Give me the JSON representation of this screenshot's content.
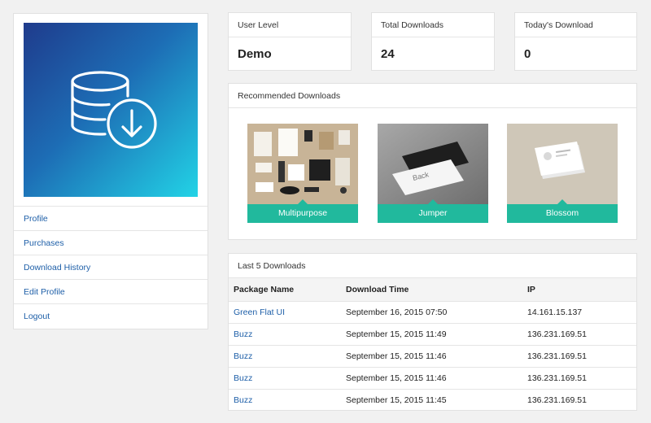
{
  "sidebar": {
    "avatar_icon": "database-download-icon",
    "menu": [
      "Profile",
      "Purchases",
      "Download History",
      "Edit Profile",
      "Logout"
    ]
  },
  "stats": [
    {
      "label": "User Level",
      "value": "Demo"
    },
    {
      "label": "Total Downloads",
      "value": "24"
    },
    {
      "label": "Today's Download",
      "value": "0"
    }
  ],
  "recommended": {
    "title": "Recommended Downloads",
    "items": [
      {
        "name": "Multipurpose"
      },
      {
        "name": "Jumper"
      },
      {
        "name": "Blossom"
      }
    ]
  },
  "downloads": {
    "title": "Last 5 Downloads",
    "columns": [
      "Package Name",
      "Download Time",
      "IP"
    ],
    "rows": [
      [
        "Green Flat UI",
        "September 16, 2015 07:50",
        "14.161.15.137"
      ],
      [
        "Buzz",
        "September 15, 2015 11:49",
        "136.231.169.51"
      ],
      [
        "Buzz",
        "September 15, 2015 11:46",
        "136.231.169.51"
      ],
      [
        "Buzz",
        "September 15, 2015 11:46",
        "136.231.169.51"
      ],
      [
        "Buzz",
        "September 15, 2015 11:45",
        "136.231.169.51"
      ]
    ]
  },
  "colors": {
    "accent": "#21b99d",
    "link": "#1e5fa8",
    "avatar_gradient_start": "#1f3b8c",
    "avatar_gradient_end": "#22d3e6"
  }
}
